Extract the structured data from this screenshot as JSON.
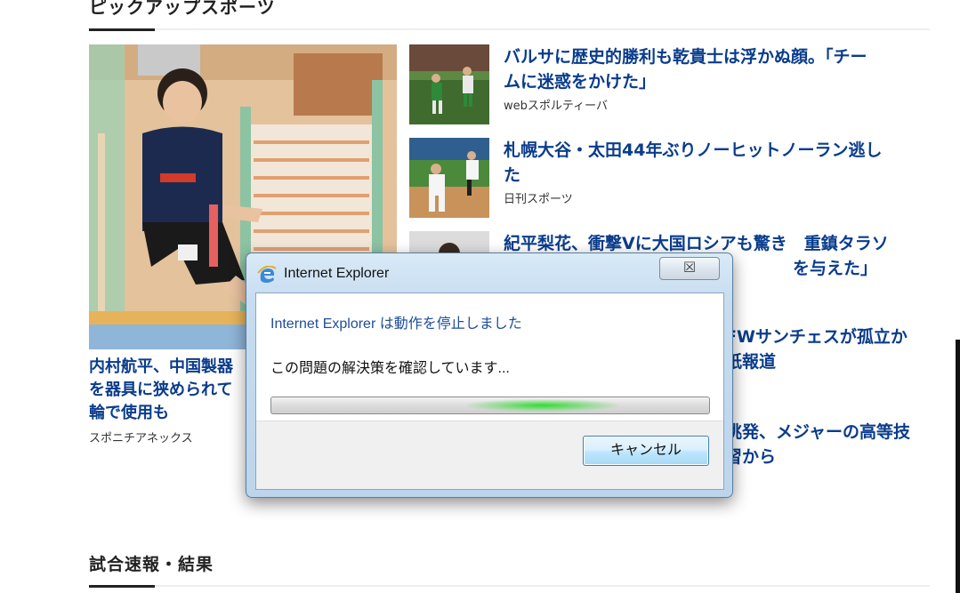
{
  "sections": {
    "pickup_title": "ピックアップスポーツ",
    "results_title": "試合速報・結果"
  },
  "feature": {
    "headline": "内村航平、中国製器具に挟められて輪で使用も",
    "headline_line1": "内村航平、中国製器",
    "headline_line2": "を器具に狭められて",
    "headline_line3": "輪で使用も",
    "source": "スポニチアネックス"
  },
  "side_items": [
    {
      "headline_line1": "バルサに歴史的勝利も乾貴士は浮かぬ顔。「チー",
      "headline_line2": "ムに迷惑をかけた」",
      "source": "webスポルティーバ"
    },
    {
      "headline_line1": "札幌大谷・太田44年ぶりノーヒットノーラン逃し",
      "headline_line2": "た",
      "source": "日刊スポーツ"
    },
    {
      "headline_line1": "紀平梨花、衝撃Vに大国ロシアも驚き　重鎮タラソ",
      "headline_line2": "を与えた」",
      "source": ""
    },
    {
      "headline_line1": "FWサンチェスが孤立か",
      "headline_line2": "紙報道",
      "source": ""
    },
    {
      "headline_line1": "挑発、メジャーの高等技",
      "headline_line2": "習から",
      "source": ""
    }
  ],
  "dialog": {
    "title": "Internet Explorer",
    "close_glyph": "☒",
    "message": "Internet Explorer は動作を停止しました",
    "status": "この問題の解決策を確認しています...",
    "cancel_label": "キャンセル"
  }
}
